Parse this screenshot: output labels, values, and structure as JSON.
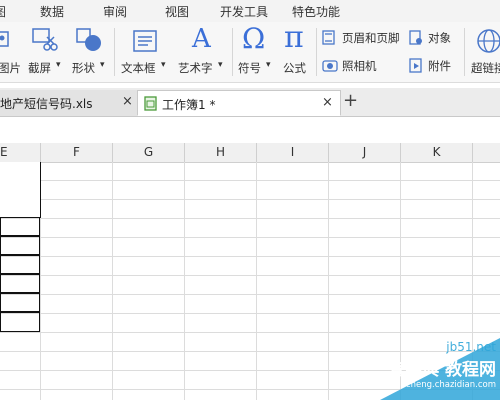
{
  "menu": {
    "items": [
      {
        "label": "图"
      },
      {
        "label": "数据"
      },
      {
        "label": "审阅"
      },
      {
        "label": "视图"
      },
      {
        "label": "开发工具"
      },
      {
        "label": "特色功能"
      }
    ]
  },
  "ribbon": {
    "picture_label": "图片",
    "screenshot_label": "截屏",
    "shapes_label": "形状",
    "textbox_label": "文本框",
    "wordart_label": "艺术字",
    "symbol_label": "符号",
    "formula_label": "公式",
    "header_footer_label": "页眉和页脚",
    "object_label": "对象",
    "camera_label": "照相机",
    "attachment_label": "附件",
    "hyperlink_label": "超链接",
    "omega_glyph": "Ω",
    "pi_glyph": "π",
    "wordart_glyph": "A",
    "dropdown_glyph": "▾"
  },
  "tabs": [
    {
      "label": "地产短信号码.xls",
      "close": "×"
    },
    {
      "label": "工作簿1 *",
      "close": "×"
    }
  ],
  "new_tab_glyph": "+",
  "columns": [
    "E",
    "F",
    "G",
    "H",
    "I",
    "J",
    "K"
  ],
  "watermark": {
    "site": "jb51.net",
    "line1": "查字典 教程网",
    "line2": "jiaocheng.chazidian.com"
  },
  "colors": {
    "accent_green": "#4a9a3a",
    "symbol_blue": "#3b6fd8",
    "watermark_teal": "#2fa6d9"
  }
}
